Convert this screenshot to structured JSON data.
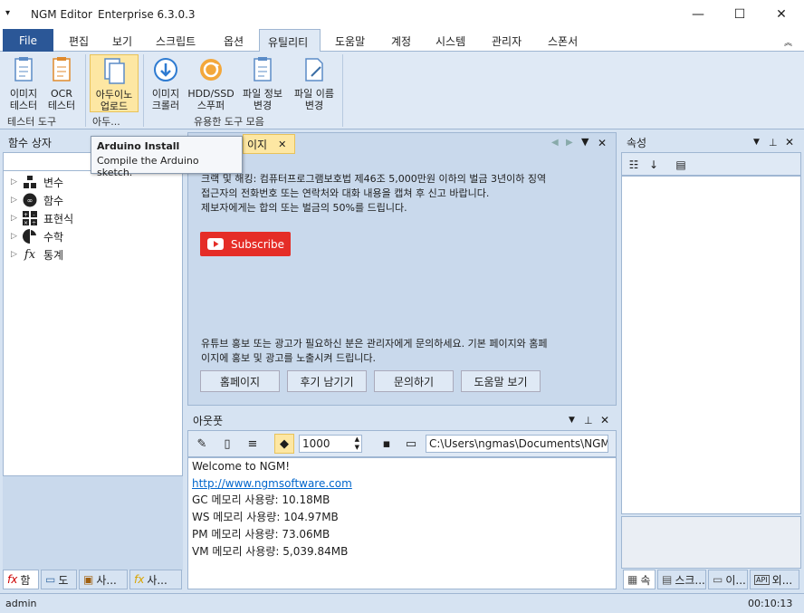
{
  "window": {
    "app_name": "NGM Editor",
    "edition": "Enterprise 6.3.0.3",
    "menu_glyph": "▾",
    "minimize": "—",
    "maximize": "☐",
    "close": "✕"
  },
  "menu": {
    "file": "File",
    "items": [
      "편집",
      "보기",
      "스크립트",
      "옵션",
      "유틸리티",
      "도움말",
      "계정",
      "시스템",
      "관리자",
      "스폰서"
    ],
    "collapse_glyph": "︽"
  },
  "ribbon": {
    "buttons": [
      {
        "label1": "이미지",
        "label2": "테스터",
        "icon": "image-tester-icon"
      },
      {
        "label1": "OCR",
        "label2": "테스터",
        "icon": "ocr-tester-icon"
      },
      {
        "label1": "아두이노",
        "label2": "업로드",
        "icon": "arduino-upload-icon"
      },
      {
        "label1": "이미지",
        "label2": "크롤러",
        "icon": "image-crawler-icon"
      },
      {
        "label1": "HDD/SSD",
        "label2": "스푸퍼",
        "icon": "spoofer-icon"
      },
      {
        "label1": "파일 정보",
        "label2": "변경",
        "icon": "file-info-icon"
      },
      {
        "label1": "파일 이름",
        "label2": "변경",
        "icon": "file-rename-icon"
      }
    ],
    "groups": [
      "테스터 도구",
      "아두...",
      "유용한 도구 모음"
    ]
  },
  "tooltip": {
    "title": "Arduino Install",
    "text": "Compile the Arduino sketch."
  },
  "left_panel": {
    "title": "함수 상자",
    "tree": [
      {
        "label": "변수",
        "icon": "variable-icon"
      },
      {
        "label": "함수",
        "icon": "function-icon"
      },
      {
        "label": "표현식",
        "icon": "expression-icon"
      },
      {
        "label": "수학",
        "icon": "math-icon"
      },
      {
        "label": "통계",
        "icon": "statistics-icon"
      }
    ],
    "bottom_tabs": [
      "함",
      "도",
      "사...",
      "사..."
    ]
  },
  "document": {
    "tab_label": "이지",
    "tab_close": "✕",
    "line1": "크랙 및 해킹: 컴퓨터프로그램보호법 제46조 5,000만원 이하의 벌금 3년이하 징역",
    "line2": "접근자의 전화번호 또는 연락처와 대화 내용을 캡쳐 후 신고 바랍니다.",
    "line3": "제보자에게는 합의 또는 벌금의 50%를 드립니다.",
    "subscribe": "Subscribe",
    "promo1": "유튜브 홍보 또는 광고가 필요하신 분은 관리자에게 문의하세요. 기본 페이지와 홈페",
    "promo2": "이지에 홍보 및 광고를 노출시켜 드립니다.",
    "buttons": [
      "홈페이지",
      "후기 남기기",
      "문의하기",
      "도움말 보기"
    ]
  },
  "output": {
    "title": "아웃풋",
    "value": "1000",
    "path": "C:\\Users\\ngmas\\Documents\\NGM6\\",
    "lines": [
      "Welcome to NGM!",
      "http://www.ngmsoftware.com",
      "GC 메모리 사용량: 10.18MB",
      "WS 메모리 사용량: 104.97MB",
      "PM 메모리 사용량: 73.06MB",
      "VM 메모리 사용량: 5,039.84MB"
    ]
  },
  "right_panel": {
    "title": "속성",
    "bottom_tabs": [
      "속",
      "스크...",
      "이...",
      "외..."
    ]
  },
  "status": {
    "user": "admin",
    "time": "00:10:13"
  },
  "colors": {
    "accent": "#2b5797",
    "subscribe": "#e52d27",
    "link": "#0066cc",
    "panel_bg": "#c9d9ec"
  }
}
